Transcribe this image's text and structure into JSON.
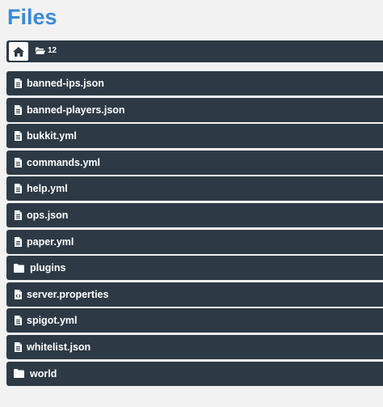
{
  "header": {
    "title": "Files"
  },
  "toolbar": {
    "home_icon": "home-icon",
    "count_icon": "folder-open-icon",
    "item_count": "12"
  },
  "files": [
    {
      "name": "banned-ips.json",
      "type": "file",
      "icon": "file-text-icon"
    },
    {
      "name": "banned-players.json",
      "type": "file",
      "icon": "file-text-icon"
    },
    {
      "name": "bukkit.yml",
      "type": "file",
      "icon": "file-text-icon"
    },
    {
      "name": "commands.yml",
      "type": "file",
      "icon": "file-text-icon"
    },
    {
      "name": "help.yml",
      "type": "file",
      "icon": "file-text-icon"
    },
    {
      "name": "ops.json",
      "type": "file",
      "icon": "file-text-icon"
    },
    {
      "name": "paper.yml",
      "type": "file",
      "icon": "file-text-icon"
    },
    {
      "name": "plugins",
      "type": "folder",
      "icon": "folder-icon"
    },
    {
      "name": "server.properties",
      "type": "file",
      "icon": "file-code-icon"
    },
    {
      "name": "spigot.yml",
      "type": "file",
      "icon": "file-text-icon"
    },
    {
      "name": "whitelist.json",
      "type": "file",
      "icon": "file-text-icon"
    },
    {
      "name": "world",
      "type": "folder",
      "icon": "folder-icon"
    }
  ],
  "colors": {
    "title": "#3b8ad6",
    "row_background": "#2d3a45",
    "page_background": "#f2f2f2",
    "text": "#ffffff"
  }
}
